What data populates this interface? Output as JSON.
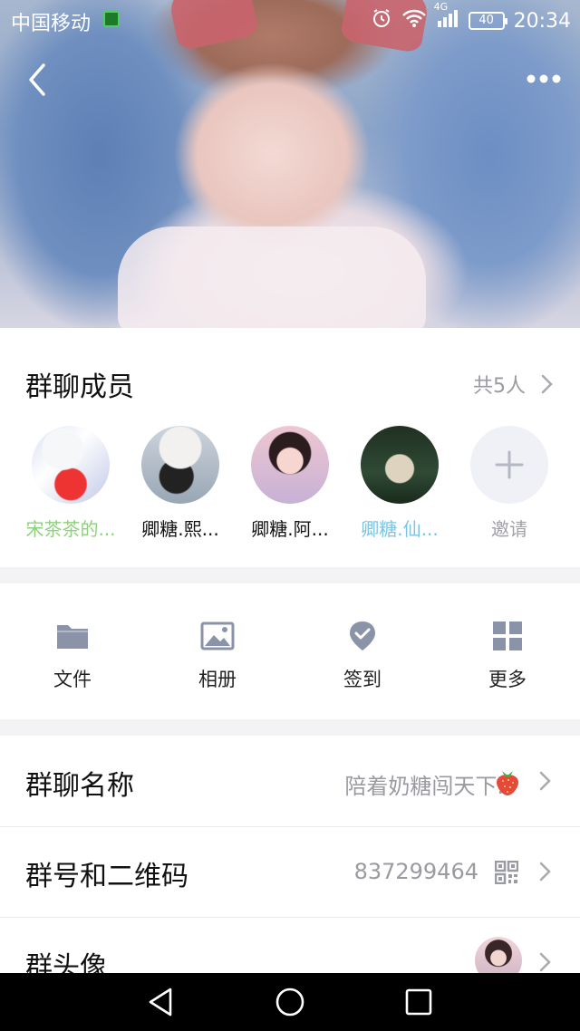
{
  "status_bar": {
    "carrier": "中国移动",
    "network": "4G",
    "battery": "40",
    "time": "20:34"
  },
  "members_section": {
    "title": "群聊成员",
    "count": "共5人",
    "members": [
      {
        "name": "宋茶茶的...",
        "color": "#8fd07e"
      },
      {
        "name": "卿糖.熙...",
        "color": "#111111"
      },
      {
        "name": "卿糖.阿...",
        "color": "#111111"
      },
      {
        "name": "卿糖.仙...",
        "color": "#7cc4e2"
      }
    ],
    "invite_label": "邀请"
  },
  "actions": [
    {
      "label": "文件",
      "icon": "folder-icon"
    },
    {
      "label": "相册",
      "icon": "image-icon"
    },
    {
      "label": "签到",
      "icon": "checkin-icon"
    },
    {
      "label": "更多",
      "icon": "grid-icon"
    }
  ],
  "settings": {
    "group_name": {
      "label": "群聊名称",
      "value": "陪着奶糖闯天下."
    },
    "group_number": {
      "label": "群号和二维码",
      "value": "837299464"
    },
    "group_avatar": {
      "label": "群头像"
    }
  },
  "colors": {
    "accent_icon": "#8a93a8",
    "muted_text": "#9a9aa2"
  }
}
